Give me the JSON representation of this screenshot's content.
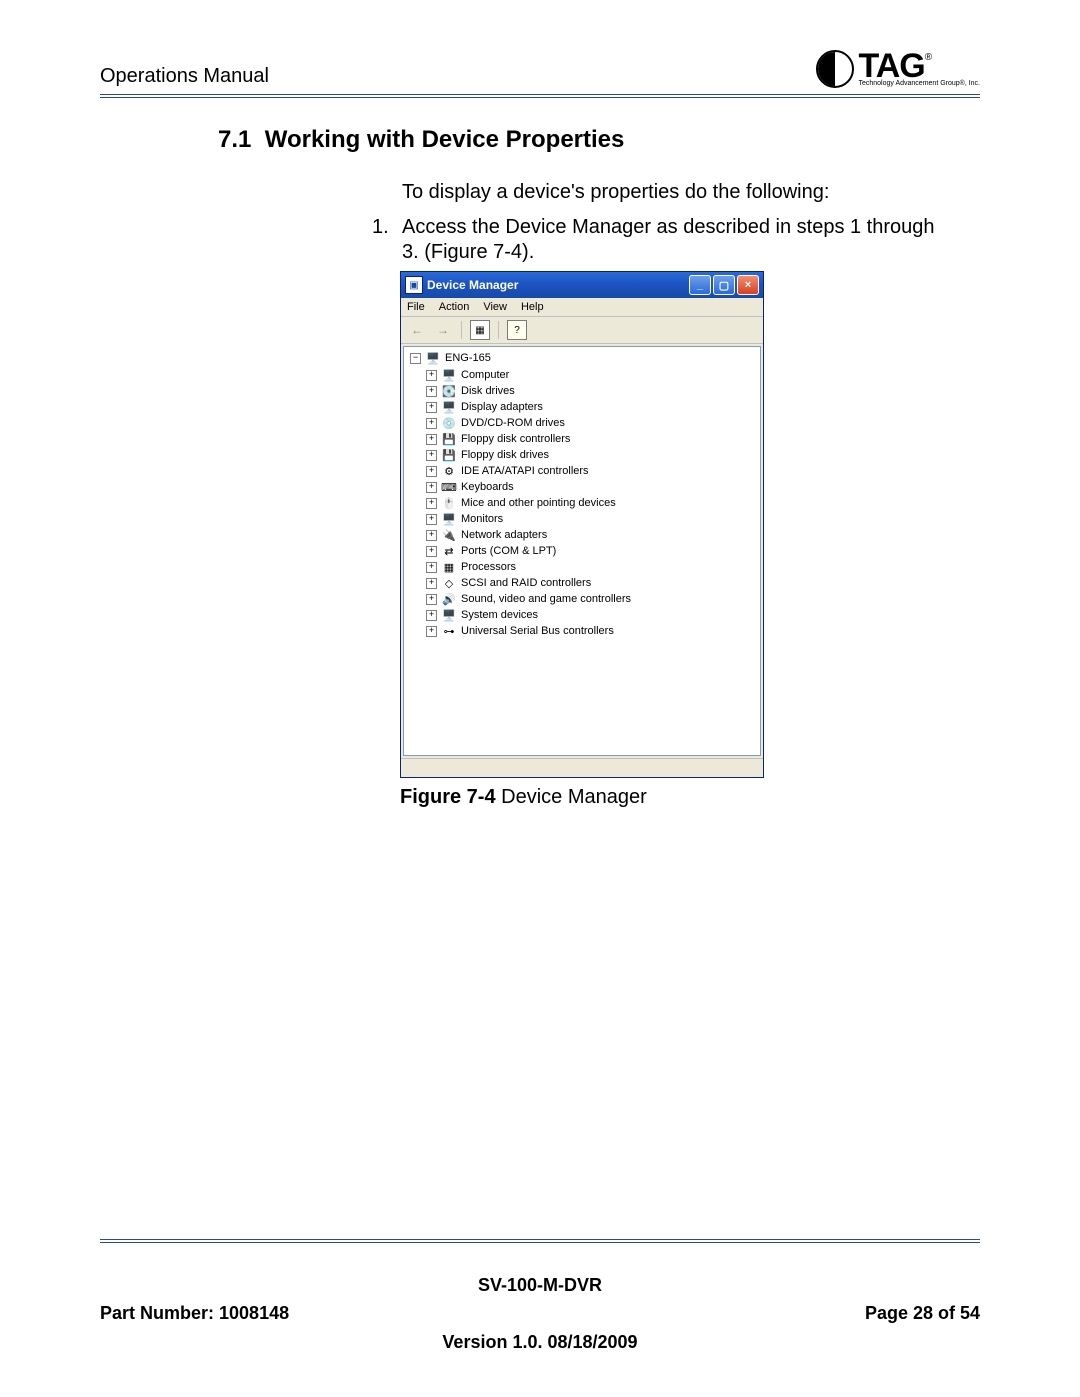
{
  "header": {
    "doc_title": "Operations Manual",
    "logo_text": "TAG",
    "logo_sub": "Technology Advancement Group®, Inc."
  },
  "section": {
    "number": "7.1",
    "title": "Working with Device Properties"
  },
  "body": {
    "intro": "To display a device's properties do the following:",
    "step1_num": "1.",
    "step1_text": "Access the Device Manager as described in steps 1 through 3. (Figure 7-4)."
  },
  "figure": {
    "label_bold": "Figure 7-4",
    "label_rest": " Device Manager"
  },
  "device_manager": {
    "window_title": "Device Manager",
    "menu": {
      "file": "File",
      "action": "Action",
      "view": "View",
      "help": "Help"
    },
    "root": "ENG-165",
    "items": [
      {
        "icon": "🖥️",
        "label": "Computer"
      },
      {
        "icon": "💽",
        "label": "Disk drives"
      },
      {
        "icon": "🖥️",
        "label": "Display adapters"
      },
      {
        "icon": "💿",
        "label": "DVD/CD-ROM drives"
      },
      {
        "icon": "💾",
        "label": "Floppy disk controllers"
      },
      {
        "icon": "💾",
        "label": "Floppy disk drives"
      },
      {
        "icon": "⚙",
        "label": "IDE ATA/ATAPI controllers"
      },
      {
        "icon": "⌨",
        "label": "Keyboards"
      },
      {
        "icon": "🖱️",
        "label": "Mice and other pointing devices"
      },
      {
        "icon": "🖥️",
        "label": "Monitors"
      },
      {
        "icon": "🔌",
        "label": "Network adapters"
      },
      {
        "icon": "⇄",
        "label": "Ports (COM & LPT)"
      },
      {
        "icon": "▦",
        "label": "Processors"
      },
      {
        "icon": "◇",
        "label": "SCSI and RAID controllers"
      },
      {
        "icon": "🔊",
        "label": "Sound, video and game controllers"
      },
      {
        "icon": "🖥️",
        "label": "System devices"
      },
      {
        "icon": "⊶",
        "label": "Universal Serial Bus controllers"
      }
    ]
  },
  "footer": {
    "model": "SV-100-M-DVR",
    "part_label": "Part Number: 1008148",
    "page_label": "Page 28 of 54",
    "version": "Version 1.0. 08/18/2009"
  }
}
